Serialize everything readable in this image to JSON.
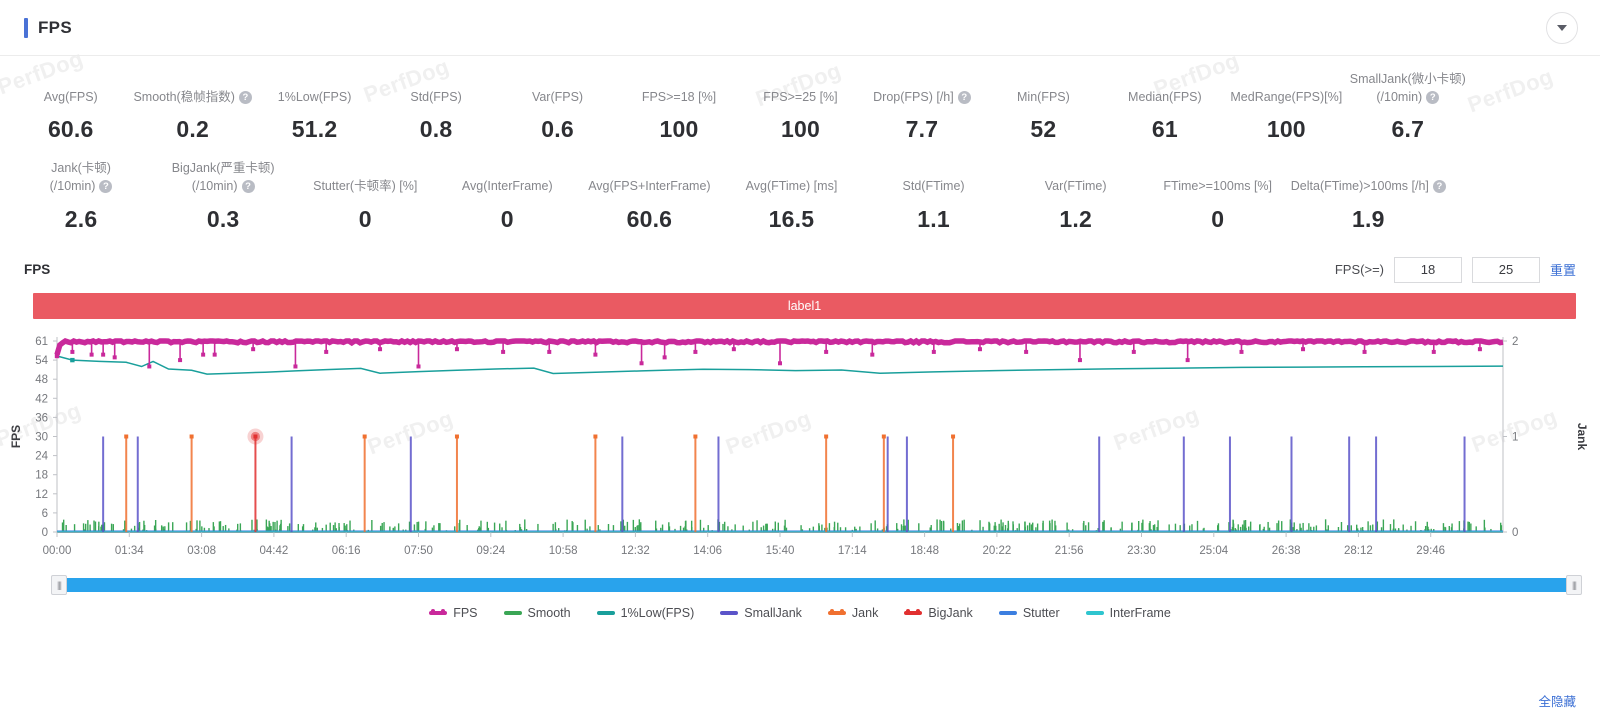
{
  "header": {
    "title": "FPS",
    "accent_color": "#4a72d6",
    "collapse_icon": "chevron-down-icon"
  },
  "watermark": {
    "text": "PerfDog"
  },
  "metrics_row1": [
    {
      "label_lines": [
        "Avg(FPS)"
      ],
      "help": false,
      "value": "60.6"
    },
    {
      "label_lines": [
        "Smooth(稳帧指数)"
      ],
      "help": true,
      "value": "0.2"
    },
    {
      "label_lines": [
        "1%Low(FPS)"
      ],
      "help": false,
      "value": "51.2"
    },
    {
      "label_lines": [
        "Std(FPS)"
      ],
      "help": false,
      "value": "0.8"
    },
    {
      "label_lines": [
        "Var(FPS)"
      ],
      "help": false,
      "value": "0.6"
    },
    {
      "label_lines": [
        "FPS>=18 [%]"
      ],
      "help": false,
      "value": "100"
    },
    {
      "label_lines": [
        "FPS>=25 [%]"
      ],
      "help": false,
      "value": "100"
    },
    {
      "label_lines": [
        "Drop(FPS) [/h]"
      ],
      "help": true,
      "value": "7.7"
    },
    {
      "label_lines": [
        "Min(FPS)"
      ],
      "help": false,
      "value": "52"
    },
    {
      "label_lines": [
        "Median(FPS)"
      ],
      "help": false,
      "value": "61"
    },
    {
      "label_lines": [
        "MedRange(FPS)[%]"
      ],
      "help": false,
      "value": "100"
    },
    {
      "label_lines": [
        "SmallJank(微小卡顿)",
        "(/10min)"
      ],
      "help": true,
      "value": "6.7"
    },
    {
      "label_lines": [
        ""
      ],
      "help": false,
      "value": ""
    }
  ],
  "metrics_row2": [
    {
      "label_lines": [
        "Jank(卡顿)",
        "(/10min)"
      ],
      "help": true,
      "value": "2.6"
    },
    {
      "label_lines": [
        "BigJank(严重卡顿)",
        "(/10min)"
      ],
      "help": true,
      "value": "0.3"
    },
    {
      "label_lines": [
        "Stutter(卡顿率) [%]"
      ],
      "help": false,
      "value": "0"
    },
    {
      "label_lines": [
        "Avg(InterFrame)"
      ],
      "help": false,
      "value": "0"
    },
    {
      "label_lines": [
        "Avg(FPS+InterFrame)"
      ],
      "help": false,
      "value": "60.6"
    },
    {
      "label_lines": [
        "Avg(FTime) [ms]"
      ],
      "help": false,
      "value": "16.5"
    },
    {
      "label_lines": [
        "Std(FTime)"
      ],
      "help": false,
      "value": "1.1"
    },
    {
      "label_lines": [
        "Var(FTime)"
      ],
      "help": false,
      "value": "1.2"
    },
    {
      "label_lines": [
        "FTime>=100ms [%]"
      ],
      "help": false,
      "value": "0"
    },
    {
      "label_lines": [
        "Delta(FTime)>100ms [/h]"
      ],
      "help": true,
      "value": "1.9"
    },
    {
      "label_lines": [
        ""
      ],
      "help": false,
      "value": ""
    }
  ],
  "chart_controls": {
    "section_label": "FPS",
    "threshold_label": "FPS(>=)",
    "threshold_1": "18",
    "threshold_2": "25",
    "reset_label": "重置"
  },
  "label_band": {
    "text": "label1",
    "color": "#ea5a62"
  },
  "range_slider": {
    "left_handle_icon": "grip-handle-icon",
    "right_handle_icon": "grip-handle-icon",
    "track_color": "#29a3ec"
  },
  "legend": {
    "hide_all_label": "全隐藏",
    "items": [
      {
        "label": "FPS",
        "color": "#c9299b",
        "dotted": true
      },
      {
        "label": "Smooth",
        "color": "#3aa655",
        "dotted": false
      },
      {
        "label": "1%Low(FPS)",
        "color": "#199f9b",
        "dotted": false
      },
      {
        "label": "SmallJank",
        "color": "#5b54c9",
        "dotted": false
      },
      {
        "label": "Jank",
        "color": "#f07030",
        "dotted": true
      },
      {
        "label": "BigJank",
        "color": "#e13030",
        "dotted": true
      },
      {
        "label": "Stutter",
        "color": "#3c7fe0",
        "dotted": false
      },
      {
        "label": "InterFrame",
        "color": "#2ec5cf",
        "dotted": false
      }
    ]
  },
  "chart_data": {
    "type": "line",
    "title": "FPS",
    "xlabel": "",
    "ylabel": "FPS",
    "y2label": "Jank",
    "grid": false,
    "legend_position": "bottom",
    "ylim": [
      0,
      61
    ],
    "yticks": [
      0,
      6,
      12,
      18,
      24,
      30,
      36,
      42,
      48,
      54,
      61
    ],
    "y2lim": [
      0,
      2
    ],
    "y2ticks": [
      0,
      1,
      2
    ],
    "xticks": [
      "00:00",
      "01:34",
      "03:08",
      "04:42",
      "06:16",
      "07:50",
      "09:24",
      "10:58",
      "12:32",
      "14:06",
      "15:40",
      "17:14",
      "18:48",
      "20:22",
      "21:56",
      "23:30",
      "25:04",
      "26:38",
      "28:12",
      "29:46"
    ],
    "x_range_seconds": [
      0,
      1880
    ],
    "series": [
      {
        "name": "FPS",
        "color": "#c9299b",
        "axis": "left",
        "description": "dense band at 60-61 with downward drop spikes",
        "baseline": 60.8,
        "drop_spikes": [
          {
            "t": 20,
            "v": 57
          },
          {
            "t": 45,
            "v": 56
          },
          {
            "t": 60,
            "v": 56
          },
          {
            "t": 75,
            "v": 55
          },
          {
            "t": 120,
            "v": 52
          },
          {
            "t": 160,
            "v": 54
          },
          {
            "t": 190,
            "v": 56
          },
          {
            "t": 205,
            "v": 56
          },
          {
            "t": 255,
            "v": 58
          },
          {
            "t": 310,
            "v": 52
          },
          {
            "t": 350,
            "v": 57
          },
          {
            "t": 420,
            "v": 58
          },
          {
            "t": 470,
            "v": 52
          },
          {
            "t": 520,
            "v": 58
          },
          {
            "t": 580,
            "v": 57
          },
          {
            "t": 640,
            "v": 57
          },
          {
            "t": 700,
            "v": 56
          },
          {
            "t": 760,
            "v": 53
          },
          {
            "t": 790,
            "v": 55
          },
          {
            "t": 830,
            "v": 57
          },
          {
            "t": 880,
            "v": 58
          },
          {
            "t": 940,
            "v": 53
          },
          {
            "t": 1000,
            "v": 57
          },
          {
            "t": 1060,
            "v": 56
          },
          {
            "t": 1140,
            "v": 57
          },
          {
            "t": 1200,
            "v": 58
          },
          {
            "t": 1260,
            "v": 57
          },
          {
            "t": 1330,
            "v": 54
          },
          {
            "t": 1400,
            "v": 57
          },
          {
            "t": 1470,
            "v": 54
          },
          {
            "t": 1540,
            "v": 57
          },
          {
            "t": 1620,
            "v": 58
          },
          {
            "t": 1700,
            "v": 57
          },
          {
            "t": 1790,
            "v": 57
          },
          {
            "t": 1850,
            "v": 58
          }
        ]
      },
      {
        "name": "1%Low(FPS)",
        "color": "#199f9b",
        "axis": "left",
        "description": "starts ~54, dips to ~49, slowly recovers to ~52",
        "points": [
          {
            "t": 0,
            "v": 55.5
          },
          {
            "t": 20,
            "v": 54.0
          },
          {
            "t": 55,
            "v": 53.6
          },
          {
            "t": 90,
            "v": 53.3
          },
          {
            "t": 110,
            "v": 52.0
          },
          {
            "t": 125,
            "v": 53.6
          },
          {
            "t": 145,
            "v": 51.2
          },
          {
            "t": 175,
            "v": 50.8
          },
          {
            "t": 195,
            "v": 49.6
          },
          {
            "t": 230,
            "v": 49.9
          },
          {
            "t": 270,
            "v": 50.2
          },
          {
            "t": 310,
            "v": 50.6
          },
          {
            "t": 350,
            "v": 51.0
          },
          {
            "t": 395,
            "v": 51.4
          },
          {
            "t": 420,
            "v": 49.9
          },
          {
            "t": 470,
            "v": 50.4
          },
          {
            "t": 520,
            "v": 50.8
          },
          {
            "t": 570,
            "v": 51.2
          },
          {
            "t": 620,
            "v": 51.5
          },
          {
            "t": 645,
            "v": 49.8
          },
          {
            "t": 700,
            "v": 50.2
          },
          {
            "t": 760,
            "v": 50.6
          },
          {
            "t": 800,
            "v": 50.9
          },
          {
            "t": 840,
            "v": 51.1
          },
          {
            "t": 900,
            "v": 51.0
          },
          {
            "t": 960,
            "v": 50.7
          },
          {
            "t": 1020,
            "v": 50.9
          },
          {
            "t": 1070,
            "v": 49.9
          },
          {
            "t": 1140,
            "v": 50.3
          },
          {
            "t": 1220,
            "v": 50.7
          },
          {
            "t": 1300,
            "v": 51.0
          },
          {
            "t": 1380,
            "v": 51.3
          },
          {
            "t": 1460,
            "v": 51.5
          },
          {
            "t": 1540,
            "v": 51.7
          },
          {
            "t": 1620,
            "v": 51.8
          },
          {
            "t": 1700,
            "v": 51.9
          },
          {
            "t": 1790,
            "v": 52.0
          },
          {
            "t": 1880,
            "v": 52.1
          }
        ]
      },
      {
        "name": "SmallJank",
        "color": "#5b54c9",
        "axis": "right",
        "description": "vertical stems to Jank=1",
        "events": [
          {
            "t": 60,
            "v": 1
          },
          {
            "t": 105,
            "v": 1
          },
          {
            "t": 305,
            "v": 1
          },
          {
            "t": 460,
            "v": 1
          },
          {
            "t": 735,
            "v": 1
          },
          {
            "t": 860,
            "v": 1
          },
          {
            "t": 1080,
            "v": 1
          },
          {
            "t": 1105,
            "v": 1
          },
          {
            "t": 1355,
            "v": 1
          },
          {
            "t": 1465,
            "v": 1
          },
          {
            "t": 1525,
            "v": 1
          },
          {
            "t": 1605,
            "v": 1
          },
          {
            "t": 1680,
            "v": 1
          },
          {
            "t": 1715,
            "v": 1
          },
          {
            "t": 1830,
            "v": 1
          }
        ]
      },
      {
        "name": "Jank",
        "color": "#f07030",
        "axis": "right",
        "description": "vertical stems with dot markers to Jank=1",
        "events": [
          {
            "t": 90,
            "v": 1
          },
          {
            "t": 175,
            "v": 1
          },
          {
            "t": 400,
            "v": 1
          },
          {
            "t": 520,
            "v": 1
          },
          {
            "t": 700,
            "v": 1
          },
          {
            "t": 830,
            "v": 1
          },
          {
            "t": 1000,
            "v": 1
          },
          {
            "t": 1075,
            "v": 1
          },
          {
            "t": 1165,
            "v": 1
          }
        ]
      },
      {
        "name": "BigJank",
        "color": "#e13030",
        "axis": "right",
        "description": "single highlighted event with glow marker",
        "events": [
          {
            "t": 258,
            "v": 1
          }
        ]
      },
      {
        "name": "Smooth",
        "color": "#3aa655",
        "axis": "left",
        "description": "dense small green spikes along the baseline near 0-4",
        "baseline": 0,
        "spike_range": [
          0.5,
          4
        ]
      },
      {
        "name": "Stutter",
        "color": "#3c7fe0",
        "axis": "left",
        "description": "flat at 0",
        "value": 0
      },
      {
        "name": "InterFrame",
        "color": "#2ec5cf",
        "axis": "left",
        "description": "flat at 0",
        "value": 0
      }
    ]
  }
}
